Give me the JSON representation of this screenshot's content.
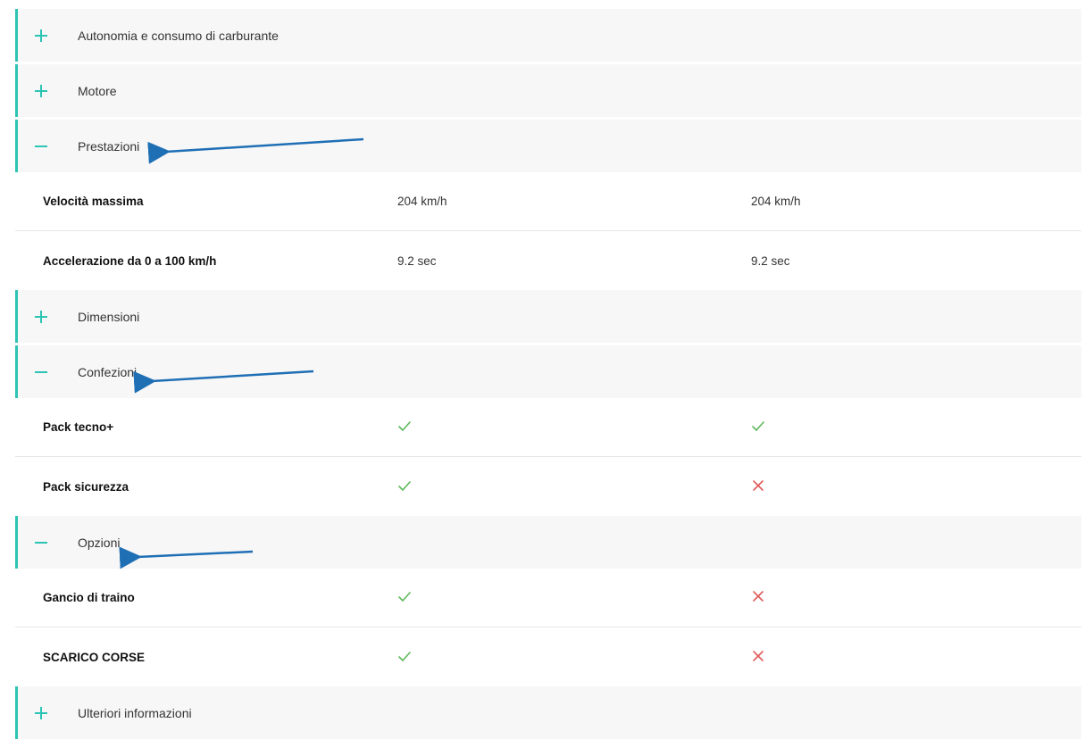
{
  "sections": {
    "autonomia": {
      "label": "Autonomia e consumo di carburante",
      "icon": "plus-icon"
    },
    "motore": {
      "label": "Motore",
      "icon": "plus-icon"
    },
    "prestazioni": {
      "label": "Prestazioni",
      "icon": "minus-icon",
      "rows": [
        {
          "label": "Velocità massima",
          "col1": "204 km/h",
          "col2": "204 km/h"
        },
        {
          "label": "Accelerazione da 0 a 100 km/h",
          "col1": "9.2 sec",
          "col2": "9.2 sec"
        }
      ]
    },
    "dimensioni": {
      "label": "Dimensioni",
      "icon": "plus-icon"
    },
    "confezioni": {
      "label": "Confezioni",
      "icon": "minus-icon",
      "rows": [
        {
          "label": "Pack tecno+",
          "col1": "check",
          "col2": "check"
        },
        {
          "label": "Pack sicurezza",
          "col1": "check",
          "col2": "cross"
        }
      ]
    },
    "opzioni": {
      "label": "Opzioni",
      "icon": "minus-icon",
      "rows": [
        {
          "label": "Gancio di traino",
          "col1": "check",
          "col2": "cross"
        },
        {
          "label": "SCARICO CORSE",
          "col1": "check",
          "col2": "cross"
        }
      ]
    },
    "ulteriori": {
      "label": "Ulteriori informazioni",
      "icon": "plus-icon"
    }
  },
  "colors": {
    "accent": "#2cc4b4",
    "check": "#5cb85c",
    "cross": "#e05a5a",
    "annotation_arrow": "#1f6fb5",
    "header_bg": "#f7f7f7"
  }
}
